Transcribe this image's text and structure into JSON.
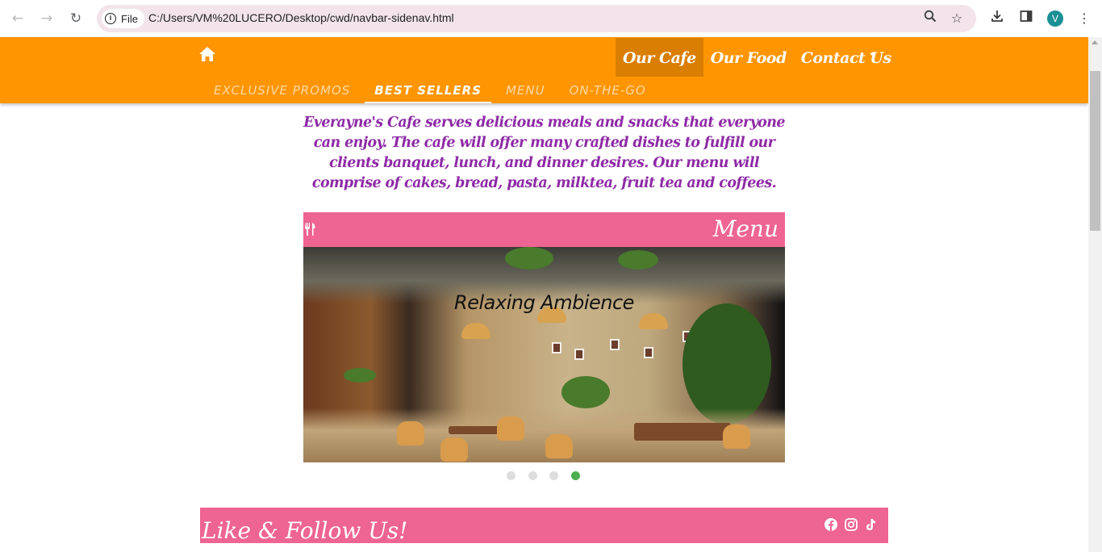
{
  "browser": {
    "chip_label": "File",
    "url": "C:/Users/VM%20LUCERO/Desktop/cwd/navbar-sidenav.html",
    "profile_initial": "V"
  },
  "nav": {
    "main_items": [
      {
        "label": "Our Cafe",
        "active": true
      },
      {
        "label": "Our Food",
        "active": false
      },
      {
        "label": "Contact Us",
        "active": false
      }
    ],
    "sub_items": [
      {
        "label": "EXCLUSIVE PROMOS",
        "active": false
      },
      {
        "label": "BEST SELLERS",
        "active": true
      },
      {
        "label": "MENU",
        "active": false
      },
      {
        "label": "ON-THE-GO",
        "active": false
      }
    ]
  },
  "intro": {
    "text": "Everayne's Cafe serves delicious meals and snacks that everyone can enjoy. The cafe will offer many crafted dishes to fulfill our clients banquet, lunch, and dinner desires. Our menu will comprise of cakes, bread, pasta, milktea, fruit tea and coffees."
  },
  "menu_section": {
    "title": "Menu",
    "slide_caption": "Relaxing Ambience",
    "slide_count": 4,
    "active_slide": 4
  },
  "follow": {
    "title": "Like & Follow Us!",
    "icons": [
      "facebook-icon",
      "instagram-icon",
      "tiktok-icon"
    ]
  },
  "colors": {
    "topbar": "#ff9500",
    "active_nav": "#d97e00",
    "pink_header": "#ee6492",
    "intro_text": "#8e2aa6",
    "active_dot": "#4caf50"
  }
}
